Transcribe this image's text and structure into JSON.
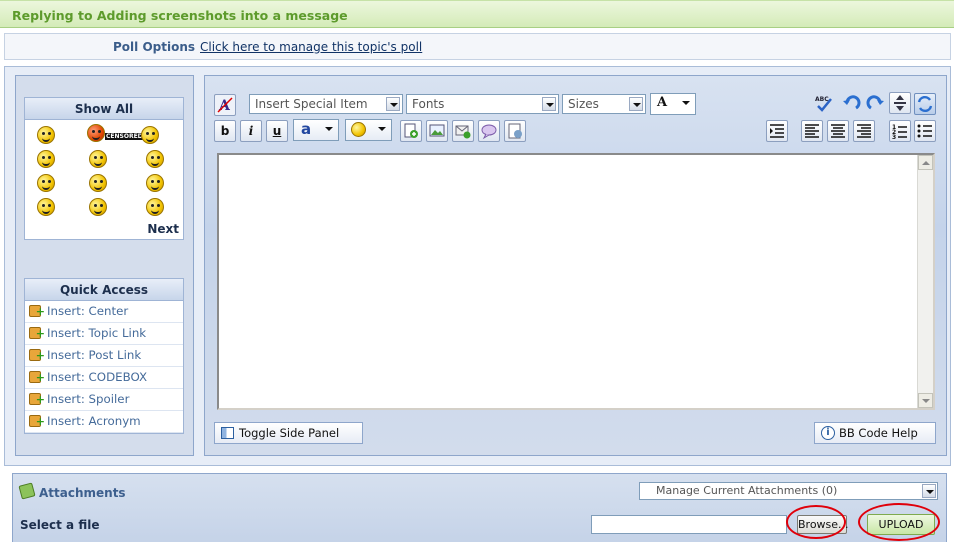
{
  "title": "Replying to Adding screenshots into a message",
  "poll": {
    "label": "Poll Options",
    "link": "Click here to manage this topic's poll"
  },
  "sidebar": {
    "emoticons_header": "Show All",
    "next_label": "Next",
    "censored_text": "CENSORED",
    "quick_access_header": "Quick Access",
    "quick_access_items": [
      {
        "label": "Insert: Center"
      },
      {
        "label": "Insert: Topic Link"
      },
      {
        "label": "Insert: Post Link"
      },
      {
        "label": "Insert: CODEBOX"
      },
      {
        "label": "Insert: Spoiler"
      },
      {
        "label": "Insert: Acronym"
      }
    ]
  },
  "toolbar": {
    "special_item": "Insert Special Item",
    "fonts": "Fonts",
    "sizes": "Sizes",
    "color_label": "A",
    "bold": "b",
    "italic": "i",
    "underline": "u",
    "font_color_label": "a",
    "spell_glyph": "ABC"
  },
  "editor": {
    "toggle_side_panel": "Toggle Side Panel",
    "bb_code_help": "BB Code Help"
  },
  "attachments": {
    "title": "Attachments",
    "manage": "Manage Current Attachments (0)",
    "select_label": "Select a file",
    "browse": "Browse...",
    "upload": "UPLOAD"
  },
  "colors": {
    "title_green": "#5d9b2c",
    "panel_blue": "#d4ddec",
    "annotation_red": "#e0000a"
  }
}
